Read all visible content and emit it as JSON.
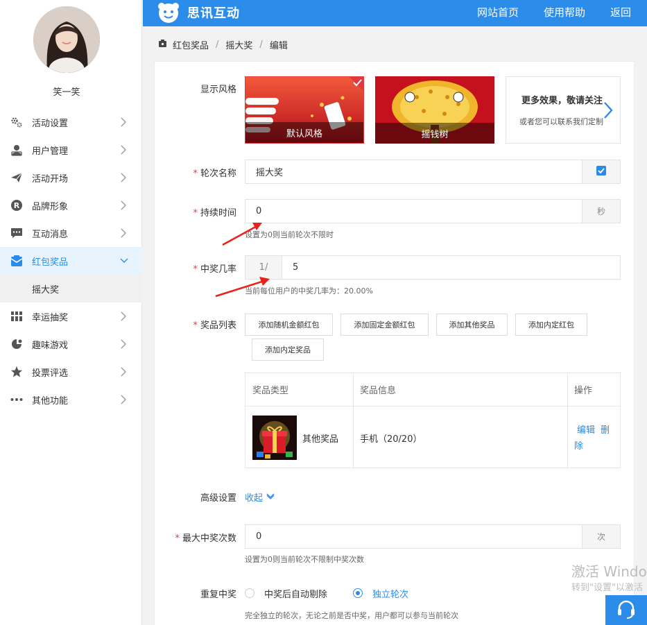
{
  "user": {
    "name": "笑一笑"
  },
  "header": {
    "brand": "思讯互动",
    "nav": [
      "网站首页",
      "使用帮助",
      "返回"
    ]
  },
  "sidebar": {
    "items": [
      {
        "label": "活动设置",
        "icon": "gear-icon"
      },
      {
        "label": "用户管理",
        "icon": "user-icon"
      },
      {
        "label": "活动开场",
        "icon": "paper-plane-icon"
      },
      {
        "label": "品牌形象",
        "icon": "registered-icon"
      },
      {
        "label": "互动消息",
        "icon": "message-icon"
      },
      {
        "label": "红包奖品",
        "icon": "red-envelope-icon",
        "active": true
      },
      {
        "label": "幸运抽奖",
        "icon": "lottery-icon"
      },
      {
        "label": "趣味游戏",
        "icon": "game-icon"
      },
      {
        "label": "投票评选",
        "icon": "star-icon"
      },
      {
        "label": "其他功能",
        "icon": "more-dots-icon"
      }
    ],
    "submenu": [
      "摇大奖"
    ]
  },
  "breadcrumb": [
    "红包奖品",
    "摇大奖",
    "编辑"
  ],
  "form": {
    "display_style": {
      "label": "显示风格",
      "cards": [
        {
          "caption": "默认风格",
          "selected": true
        },
        {
          "caption": "摇钱树",
          "selected": false
        }
      ],
      "more_title": "更多效果，敬请关注",
      "more_sub": "或者您可以联系我们定制"
    },
    "round_name": {
      "label": "轮次名称",
      "value": "摇大奖",
      "checked": true
    },
    "duration": {
      "label": "持续时间",
      "value": "0",
      "unit": "秒",
      "hint": "设置为0则当前轮次不限时"
    },
    "win_rate": {
      "label": "中奖几率",
      "prefix": "1/",
      "value": "5",
      "hint": "当前每位用户的中奖几率为：20.00%"
    },
    "prize_list": {
      "label": "奖品列表",
      "buttons": [
        "添加随机金额红包",
        "添加固定金额红包",
        "添加其他奖品",
        "添加内定红包",
        "添加内定奖品"
      ],
      "columns": [
        "奖品类型",
        "奖品信息",
        "操作"
      ],
      "rows": [
        {
          "type": "其他奖品",
          "info": "手机（20/20）",
          "edit": "编辑",
          "delete": "删除"
        }
      ]
    },
    "advanced": {
      "label": "高级设置",
      "toggle": "收起"
    },
    "max_wins": {
      "label": "最大中奖次数",
      "value": "0",
      "unit": "次",
      "hint": "设置为0则当前轮次不限制中奖次数"
    },
    "repeat_win": {
      "label": "重复中奖",
      "options": [
        {
          "label": "中奖后自动剔除",
          "selected": false
        },
        {
          "label": "独立轮次",
          "selected": true
        }
      ],
      "hint": "完全独立的轮次，无论之前是否中奖，用户都可以参与当前轮次"
    }
  },
  "watermark": {
    "line1": "激活 Windo",
    "line2": "转到\"设置\"以激活"
  },
  "colors": {
    "primary": "#2b8ce9",
    "required": "#e4393c",
    "annotation": "#e8231c"
  }
}
